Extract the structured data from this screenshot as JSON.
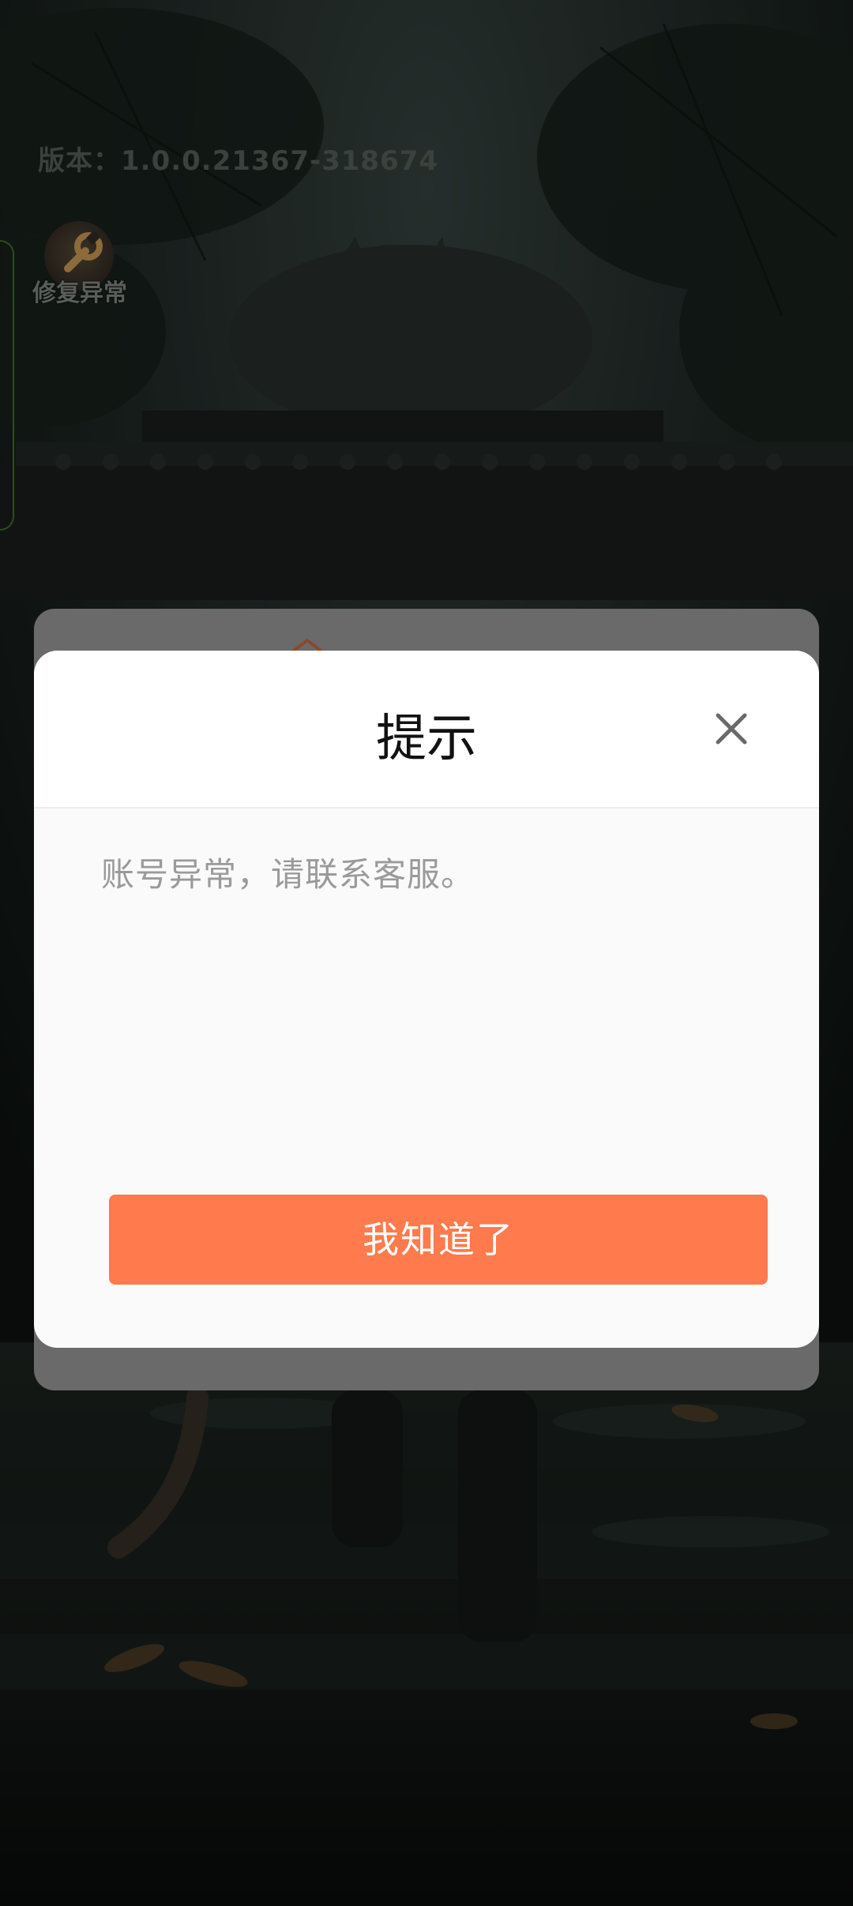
{
  "app": {
    "version": "版本：1.0.0.21367-318674"
  },
  "repair": {
    "label": "修复异常",
    "icon": "wrench-icon"
  },
  "dialog": {
    "title": "提示",
    "message": "账号异常，请联系客服。",
    "confirm_label": "我知道了",
    "close_icon": "close-icon"
  },
  "colors": {
    "accent": "#ff7a4c",
    "dialog_bg": "#fafafa",
    "message_text": "#9a9a9a"
  }
}
